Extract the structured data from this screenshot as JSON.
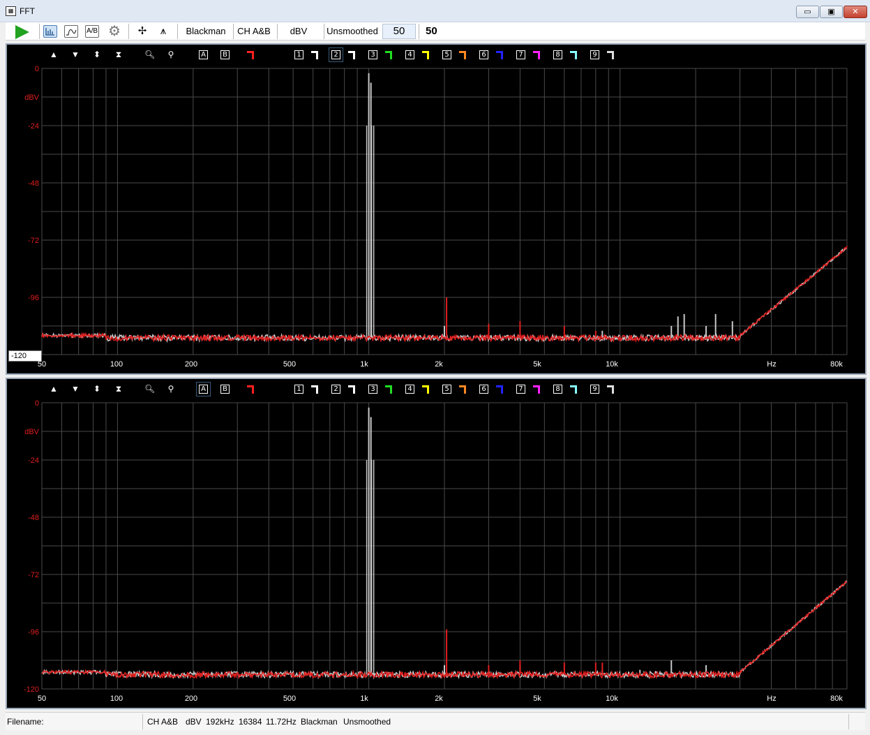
{
  "window": {
    "title": "FFT",
    "minimize": "▭",
    "maximize": "▣",
    "close": "✕"
  },
  "toolbar": {
    "icons": [
      "play-icon",
      "spectrum-icon",
      "curve-icon",
      "ab-icon",
      "settings-icon",
      "cursor-icon",
      "peak-icon"
    ],
    "ab_label": "A/B",
    "window_fn": "Blackman",
    "channel": "CH A&B",
    "units": "dBV",
    "smoothing": "Unsmoothed",
    "avg_input": "50",
    "avg_value": "50"
  },
  "plot_toolbar": {
    "a_label": "A",
    "b_label": "B",
    "traces": [
      {
        "num": "1",
        "color": "#ffffff"
      },
      {
        "num": "2",
        "color": "#ffffff"
      },
      {
        "num": "3",
        "color": "#22dd22"
      },
      {
        "num": "4",
        "color": "#ffff00"
      },
      {
        "num": "5",
        "color": "#ff8822"
      },
      {
        "num": "6",
        "color": "#2222ff"
      },
      {
        "num": "7",
        "color": "#ff22ff"
      },
      {
        "num": "8",
        "color": "#88ffff"
      },
      {
        "num": "9",
        "color": "#dddddd"
      }
    ],
    "marker_color": "#ff2020"
  },
  "colors": {
    "channel_a": "#e01e1e",
    "channel_b": "#c8c8c8",
    "grid": "#4a4a4a",
    "ylabel": "#e01e1e"
  },
  "panels": [
    {
      "y_input": "-120",
      "y_units": "dBV",
      "y_ticks": [
        "0",
        "-24",
        "-48",
        "-72",
        "-96"
      ],
      "x_ticks": [
        "50",
        "100",
        "200",
        "500",
        "1k",
        "2k",
        "5k",
        "10k",
        "Hz",
        "80k"
      ]
    },
    {
      "y_input": "",
      "y_units": "dBV",
      "y_ticks": [
        "0",
        "-24",
        "-48",
        "-72",
        "-96",
        "-120"
      ],
      "x_ticks": [
        "50",
        "100",
        "200",
        "500",
        "1k",
        "2k",
        "5k",
        "10k",
        "Hz",
        "80k"
      ]
    }
  ],
  "chart_data": [
    {
      "type": "line",
      "xlabel": "Hz",
      "ylabel": "dBV",
      "x_scale": "log",
      "xlim": [
        50,
        80000
      ],
      "ylim": [
        -120,
        0
      ],
      "grid": true,
      "series": [
        {
          "color": "#c8c8c8",
          "floor": -113,
          "peaks": [
            [
              1000,
              -2
            ],
            [
              1020,
              -6
            ],
            [
              2000,
              -108
            ],
            [
              8500,
              -110
            ],
            [
              16000,
              -108
            ],
            [
              17000,
              -104
            ],
            [
              18000,
              -103
            ],
            [
              22000,
              -108
            ],
            [
              24000,
              -103
            ],
            [
              28000,
              -106
            ]
          ],
          "rise": [
            [
              30000,
              -112
            ],
            [
              80000,
              -75
            ]
          ]
        },
        {
          "color": "#e01e1e",
          "floor": -113,
          "peaks": [
            [
              2040,
              -96
            ],
            [
              3000,
              -107
            ],
            [
              4000,
              -106
            ],
            [
              6000,
              -108
            ],
            [
              8000,
              -110
            ]
          ],
          "rise": [
            [
              30000,
              -112
            ],
            [
              80000,
              -75
            ]
          ]
        }
      ]
    },
    {
      "type": "line",
      "xlabel": "Hz",
      "ylabel": "dBV",
      "x_scale": "log",
      "xlim": [
        50,
        80000
      ],
      "ylim": [
        -120,
        0
      ],
      "grid": true,
      "series": [
        {
          "color": "#c8c8c8",
          "floor": -114,
          "peaks": [
            [
              1000,
              -2
            ],
            [
              1020,
              -6
            ],
            [
              2000,
              -110
            ],
            [
              4000,
              -110
            ],
            [
              8500,
              -112
            ],
            [
              12000,
              -112
            ],
            [
              16000,
              -108
            ],
            [
              22000,
              -110
            ]
          ],
          "rise": [
            [
              30000,
              -113
            ],
            [
              80000,
              -75
            ]
          ]
        },
        {
          "color": "#e01e1e",
          "floor": -114,
          "peaks": [
            [
              2040,
              -95
            ],
            [
              3000,
              -110
            ],
            [
              4000,
              -108
            ],
            [
              6000,
              -109
            ],
            [
              8000,
              -109
            ],
            [
              8500,
              -109
            ]
          ],
          "rise": [
            [
              30000,
              -113
            ],
            [
              80000,
              -75
            ]
          ]
        }
      ]
    }
  ],
  "status": {
    "filename_label": "Filename:",
    "channel": "CH A&B",
    "units": "dBV",
    "rate": "192kHz",
    "size": "16384",
    "resolution": "11.72Hz",
    "window_fn": "Blackman",
    "smoothing": "Unsmoothed"
  }
}
